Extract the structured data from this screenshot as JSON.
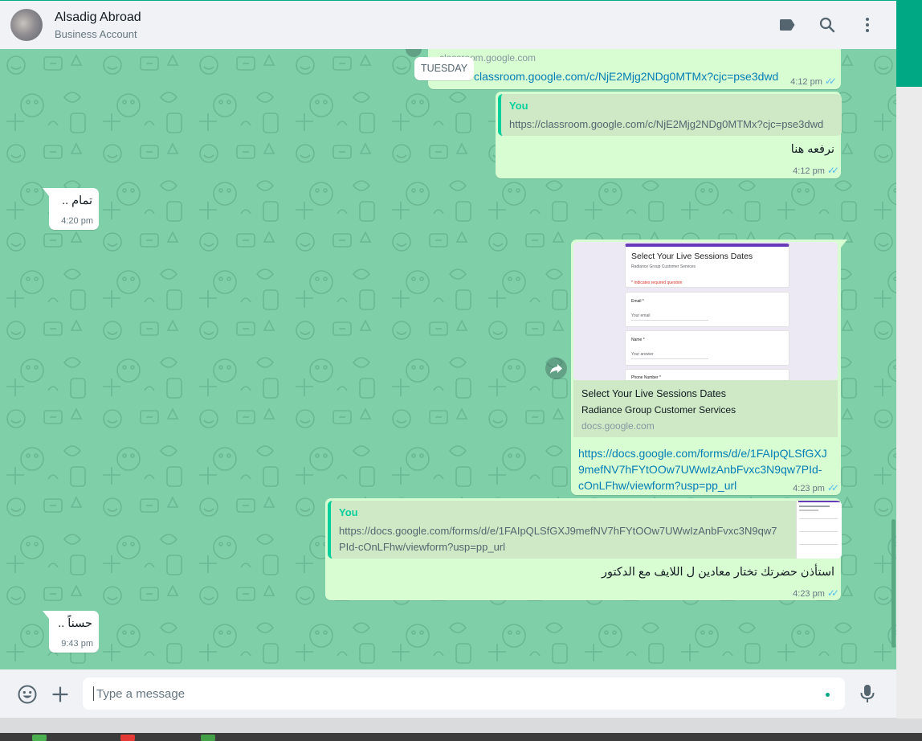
{
  "header": {
    "name": "Alsadig Abroad",
    "subtitle": "Business Account",
    "icons": [
      "label-icon",
      "search-icon",
      "menu-icon"
    ]
  },
  "date_chip": "TUESDAY",
  "messages": {
    "m0": {
      "domain": "classroom.google.com",
      "link": "classroom.google.com/c/NjE2Mjg2NDg0MTMx?cjc=pse3dwd",
      "time": "4:12 pm"
    },
    "m1": {
      "quote_author": "You",
      "quote_text": "https://classroom.google.com/c/NjE2Mjg2NDg0MTMx?cjc=pse3dwd",
      "text": "نرفعه هنا",
      "time": "4:12 pm"
    },
    "m2": {
      "text": "تمام ..",
      "time": "4:20 pm"
    },
    "m3": {
      "form_title": "Select Your Live Sessions Dates",
      "form_org": "Radiance Group Customer Services",
      "form_required": "* Indicates required question",
      "form_q1": "Email *",
      "form_q2": "Name *",
      "form_q3": "Phone Number *",
      "form_answer": "Your answer",
      "form_answer_email": "Your email",
      "title": "Select Your Live Sessions Dates",
      "description": "Radiance Group Customer Services",
      "domain": "docs.google.com",
      "link_line1": "https://docs.google.com/forms/d/e/1FAIpQLSfGXJ",
      "link_line2": "9mefNV7hFYtOOw7UWwIzAnbFvxc3N9qw7PId-",
      "link_line3": "cOnLFhw/viewform?usp=pp_url",
      "time": "4:23 pm"
    },
    "m4": {
      "quote_author": "You",
      "quote_line1": "https://docs.google.com/forms/d/e/1FAIpQLSfGXJ9mefNV7hFYtOOw7UWwIzAnbFvxc3N9qw7",
      "quote_line2": "PId-cOnLFhw/viewform?usp=pp_url",
      "text": "استأذن حضرتك تختار معادين ل اللايف مع الدكتور",
      "time": "4:23 pm"
    },
    "m5": {
      "text": "حسناً ..",
      "time": "9:43 pm"
    }
  },
  "composer": {
    "placeholder": "Type a message",
    "icons": [
      "emoji-icon",
      "attach-plus-icon",
      "microphone-icon"
    ]
  },
  "colors": {
    "accent": "#00a884",
    "chat_background": "#7fd0a9",
    "outgoing_bubble": "#d9fdd3",
    "incoming_bubble": "#ffffff",
    "link": "#027eb5",
    "read_ticks": "#53bdeb"
  }
}
